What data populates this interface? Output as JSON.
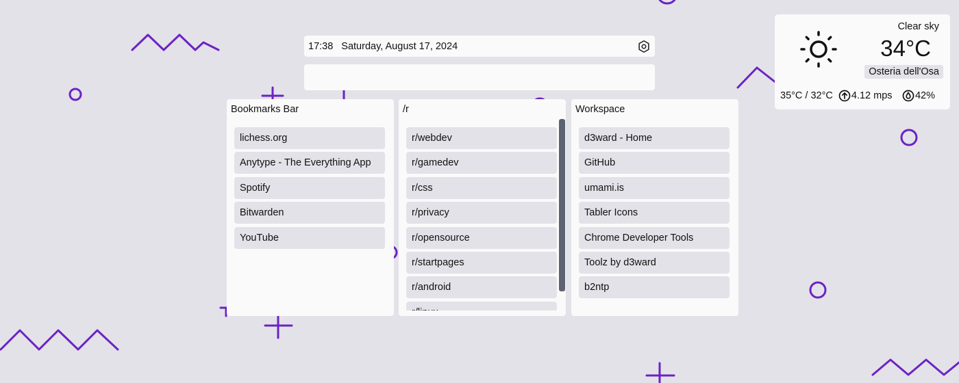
{
  "colors": {
    "background": "#e2e2e8",
    "card": "#fafafa",
    "item": "#e2e2e8",
    "accent": "#6c22c4",
    "scrollbar": "#5e6270"
  },
  "clock": {
    "time": "17:38",
    "date": "Saturday, August 17, 2024",
    "settings_icon": "hexagon-settings-icon"
  },
  "search": {
    "value": "",
    "placeholder": ""
  },
  "panels": [
    {
      "title": "Bookmarks Bar",
      "items": [
        "lichess.org",
        "Anytype - The Everything App",
        "Spotify",
        "Bitwarden",
        "YouTube"
      ]
    },
    {
      "title": "/r",
      "items": [
        "r/webdev",
        "r/gamedev",
        "r/css",
        "r/privacy",
        "r/opensource",
        "r/startpages",
        "r/android",
        "r/linux"
      ]
    },
    {
      "title": "Workspace",
      "items": [
        "d3ward - Home",
        "GitHub",
        "umami.is",
        "Tabler Icons",
        "Chrome Developer Tools",
        "Toolz by d3ward",
        "b2ntp"
      ]
    }
  ],
  "weather": {
    "condition": "Clear sky",
    "temperature": "34°C",
    "location": "Osteria dell'Osa",
    "high_low": "35°C / 32°C",
    "wind": "4.12 mps",
    "humidity": "42%",
    "icons": {
      "condition": "sun-icon",
      "wind": "arrow-up-circle-icon",
      "humidity": "droplet-icon"
    }
  }
}
